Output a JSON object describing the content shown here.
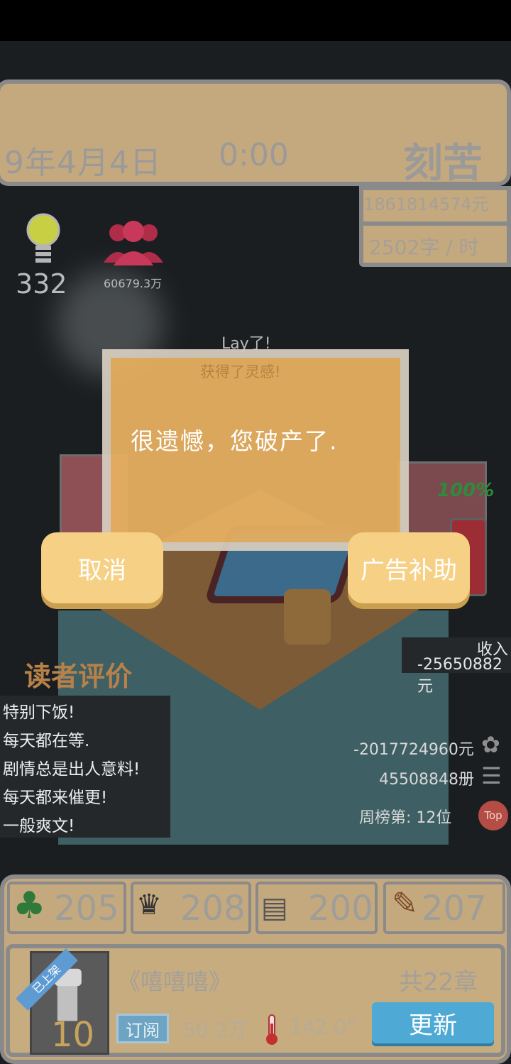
{
  "header": {
    "date": "9年4月4日",
    "time": "0:00",
    "mode": "刻苦",
    "money": "1861814574元",
    "speed": "2502字 / 时"
  },
  "status": {
    "idea_count": "332",
    "fans_count": "60679.3万"
  },
  "scene": {
    "lay_text": "Lay了!",
    "battery_pct": "100%"
  },
  "dialog": {
    "hint": "获得了灵感!",
    "message": "很遗憾，您破产了.",
    "cancel_label": "取消",
    "ad_label": "广告补助"
  },
  "income": {
    "label": "收入",
    "value": "-25650882元"
  },
  "reviews": {
    "title": "读者评价",
    "items": [
      "特别下饭!",
      "每天都在等.",
      "剧情总是出人意料!",
      "每天都来催更!",
      "一般爽文!"
    ]
  },
  "stats": {
    "total_money": "-2017724960元",
    "books_sold": "45508848册",
    "weekly_rank": "周榜第: 12位",
    "top_badge": "Top"
  },
  "attributes": {
    "tree": "205",
    "hat": "208",
    "book": "200",
    "pencil": "207"
  },
  "book": {
    "ribbon": "已上架",
    "cover_num": "10",
    "title": "《嘻嘻嘻》",
    "chapters": "共22章",
    "subscribe_label": "订阅",
    "subscribers": "50.2万",
    "heat": "142.0°",
    "update_label": "更新"
  }
}
